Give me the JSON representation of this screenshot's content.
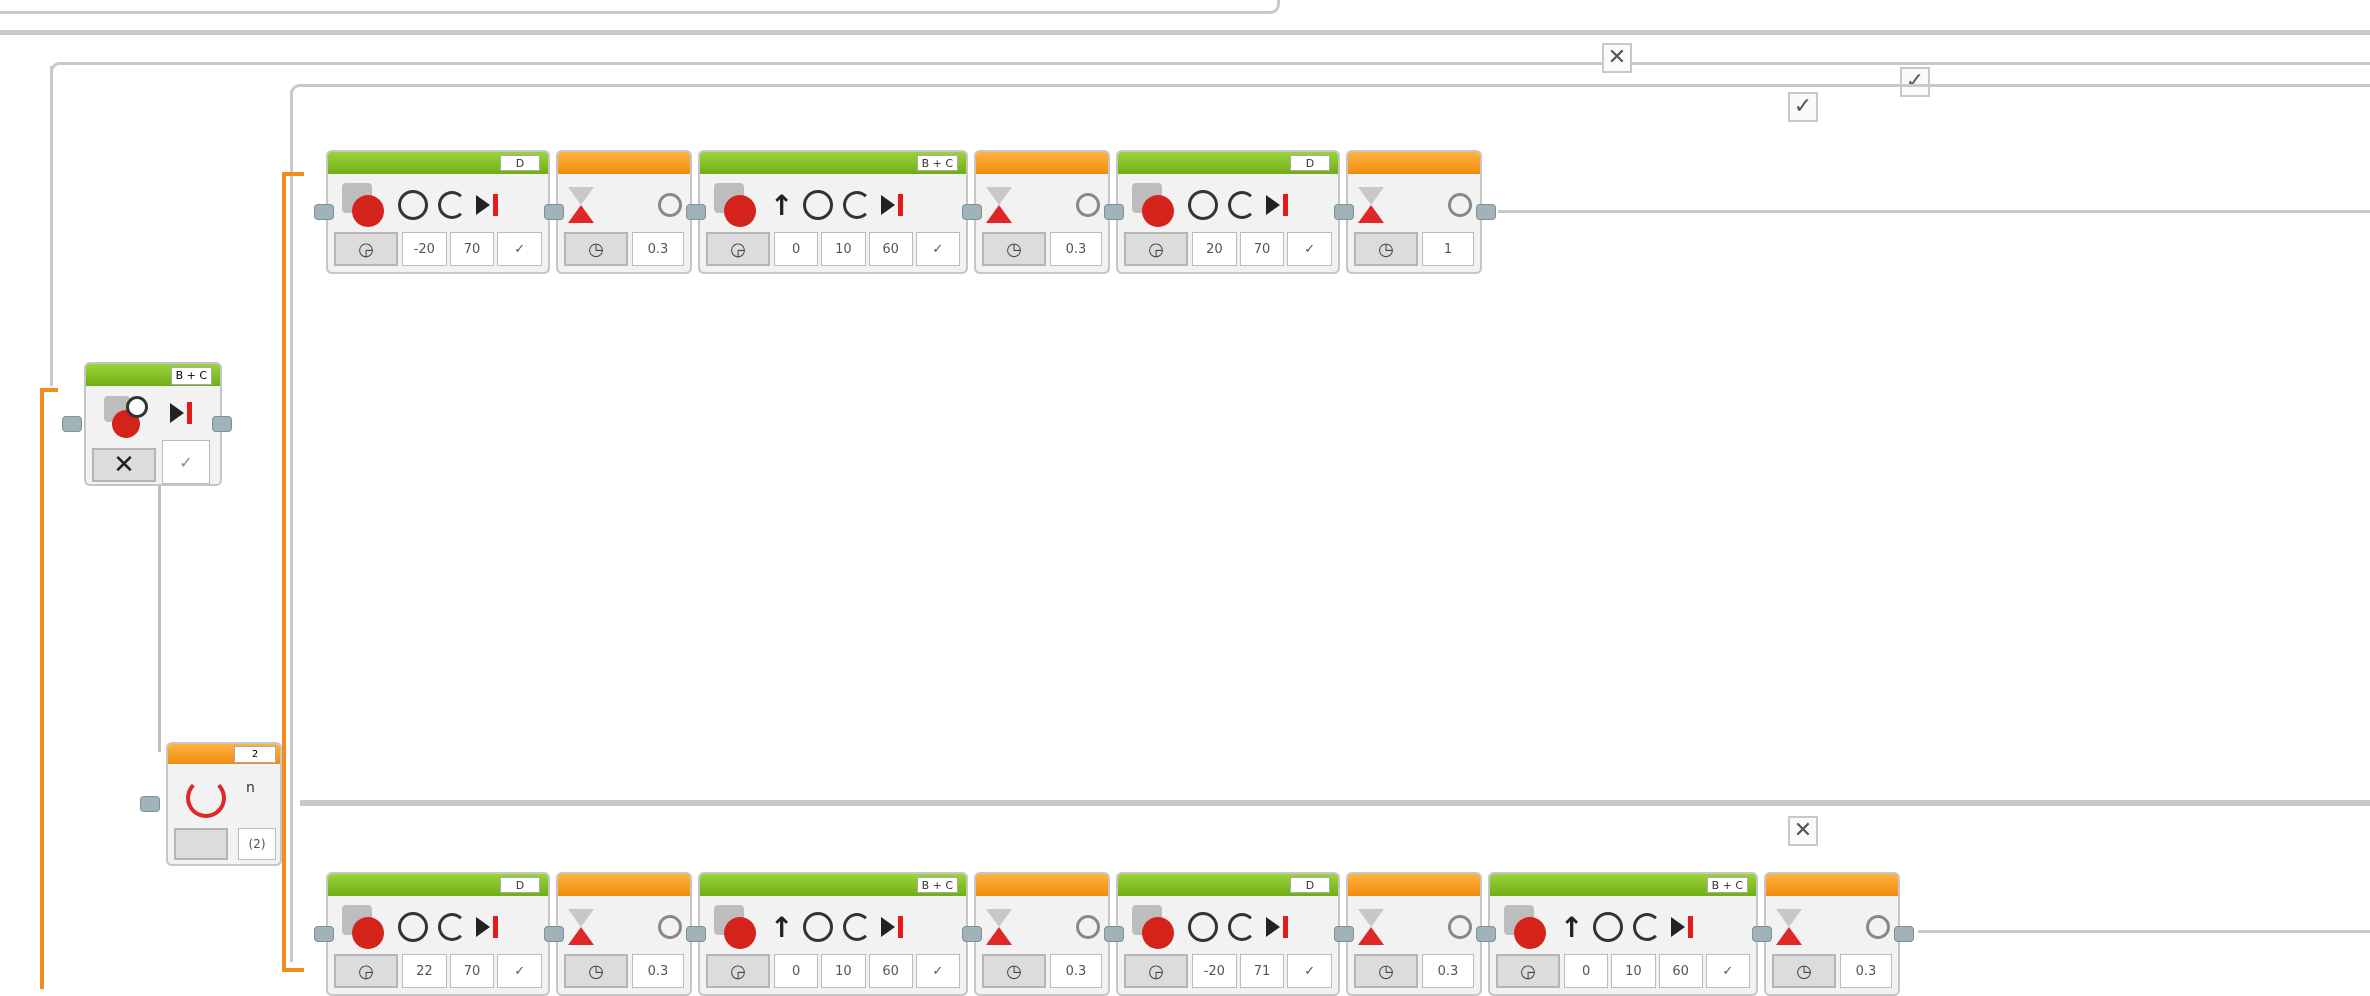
{
  "switch": {
    "close_marker": "✕",
    "check_marker": "✓"
  },
  "steering_block": {
    "port": "B + C",
    "mode_icon": "✕",
    "value": "✓"
  },
  "loop_block": {
    "label": "2",
    "count_label": "n",
    "mode_value": "(2)"
  },
  "top_row": [
    {
      "type": "motor",
      "port": "D",
      "values": [
        "-20",
        "70",
        "✓"
      ]
    },
    {
      "type": "wait",
      "values": [
        "0.3"
      ]
    },
    {
      "type": "steering",
      "port": "B + C",
      "values": [
        "0",
        "10",
        "60",
        "✓"
      ]
    },
    {
      "type": "wait",
      "values": [
        "0.3"
      ]
    },
    {
      "type": "motor",
      "port": "D",
      "values": [
        "20",
        "70",
        "✓"
      ]
    },
    {
      "type": "wait",
      "values": [
        "1"
      ]
    }
  ],
  "bottom_row": [
    {
      "type": "motor",
      "port": "D",
      "values": [
        "22",
        "70",
        "✓"
      ]
    },
    {
      "type": "wait",
      "values": [
        "0.3"
      ]
    },
    {
      "type": "steering",
      "port": "B + C",
      "values": [
        "0",
        "10",
        "60",
        "✓"
      ]
    },
    {
      "type": "wait",
      "values": [
        "0.3"
      ]
    },
    {
      "type": "motor",
      "port": "D",
      "values": [
        "-20",
        "71",
        "✓"
      ]
    },
    {
      "type": "wait",
      "values": [
        "0.3"
      ]
    },
    {
      "type": "steering",
      "port": "B + C",
      "values": [
        "0",
        "10",
        "60",
        "✓"
      ]
    },
    {
      "type": "wait",
      "values": [
        "0.3"
      ]
    }
  ],
  "colors": {
    "motor_header": "#7fbf1e",
    "wait_header": "#f5a021",
    "wire_orange": "#f28c1f",
    "wire_gray": "#bdbdbd"
  }
}
